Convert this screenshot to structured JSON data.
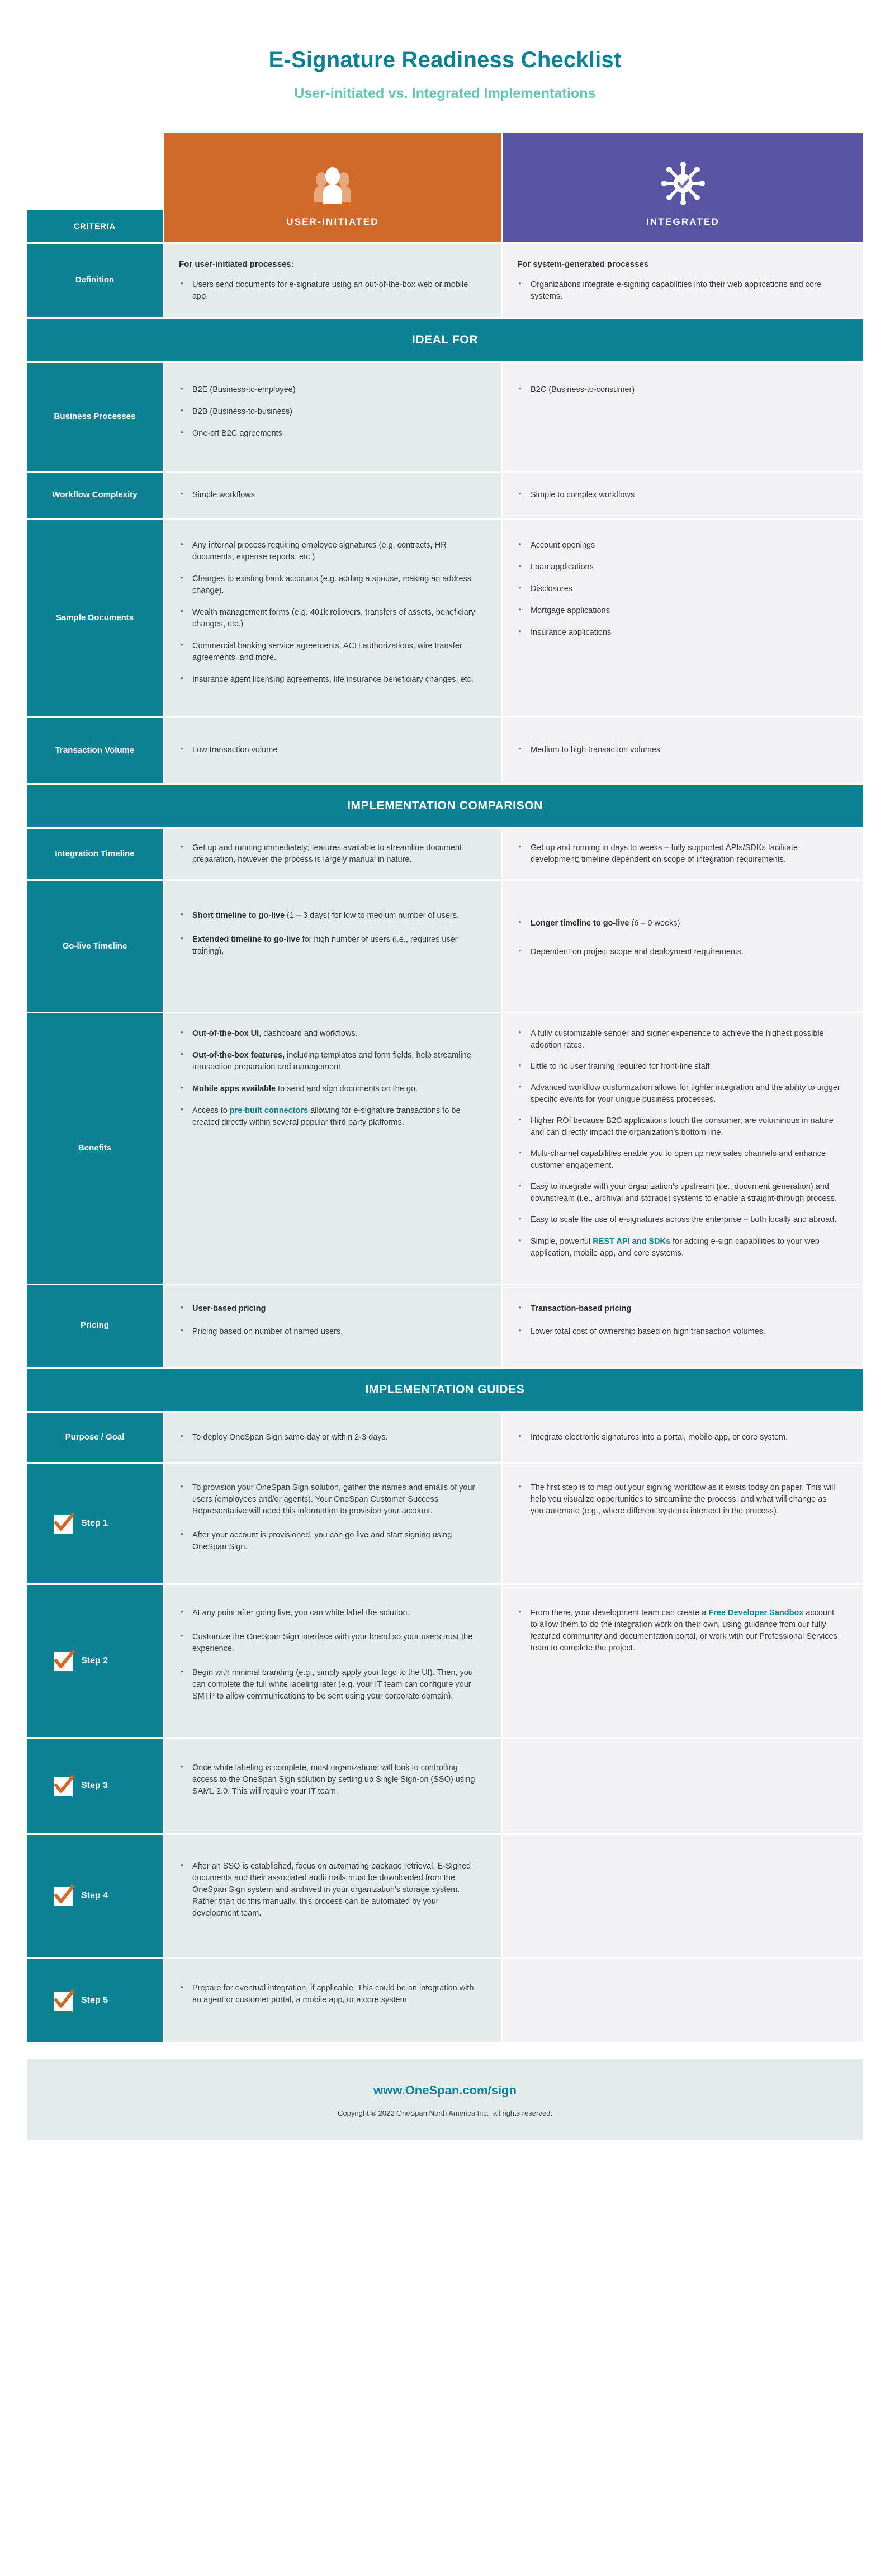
{
  "header": {
    "title": "E-Signature Readiness Checklist",
    "subtitle": "User-initiated vs. Integrated Implementations"
  },
  "colors": {
    "teal": "#0d8295",
    "title_teal": "#0b8294",
    "mint": "#63c6b3",
    "orange": "#d26a2c",
    "purple": "#5a55a3",
    "col_a_bg": "#e3ebeb",
    "col_b_bg": "#f1f1f6",
    "link": "#0d8295"
  },
  "table_head": {
    "criteria_label": "CRITERIA",
    "col_a_label": "USER-INITIATED",
    "col_b_label": "INTEGRATED",
    "col_a_icon": "users-group-icon",
    "col_b_icon": "integration-hub-check-icon"
  },
  "banners": {
    "ideal_for": "IDEAL FOR",
    "implementation_comparison": "IMPLEMENTATION COMPARISON",
    "implementation_guides": "IMPLEMENTATION GUIDES"
  },
  "rows": {
    "definition": {
      "label": "Definition",
      "a_lead": "For user-initiated processes:",
      "a_items": [
        "Users send documents for e-signature using an out-of-the-box web or mobile app."
      ],
      "b_lead": "For system-generated processes",
      "b_items": [
        "Organizations integrate e-signing capabilities into their web applications and core systems."
      ]
    },
    "business_processes": {
      "label": "Business Processes",
      "a_items": [
        "B2E (Business-to-employee)",
        "B2B (Business-to-business)",
        "One-off B2C agreements"
      ],
      "b_items": [
        "B2C (Business-to-consumer)"
      ]
    },
    "workflow_complexity": {
      "label": "Workflow Complexity",
      "a_items": [
        "Simple workflows"
      ],
      "b_items": [
        "Simple to complex workflows"
      ]
    },
    "sample_documents": {
      "label": "Sample Documents",
      "a_items": [
        "Any internal process requiring employee signatures (e.g. contracts, HR documents, expense reports, etc.).",
        "Changes to existing bank accounts (e.g. adding a spouse, making an address change).",
        "Wealth management forms (e.g. 401k rollovers, transfers of assets, beneficiary changes, etc.)",
        "Commercial banking service agreements, ACH authorizations, wire transfer agreements, and more.",
        "Insurance agent licensing agreements, life insurance beneficiary changes, etc."
      ],
      "b_items": [
        "Account openings",
        "Loan applications",
        "Disclosures",
        "Mortgage applications",
        "Insurance applications"
      ]
    },
    "transaction_volume": {
      "label": "Transaction Volume",
      "a_items": [
        "Low transaction volume"
      ],
      "b_items": [
        "Medium to high transaction volumes"
      ]
    },
    "integration_timeline": {
      "label": "Integration Timeline",
      "a_items": [
        "Get up and running immediately; features available to streamline document preparation, however the process is largely manual in nature."
      ],
      "b_items": [
        "Get up and running in days to weeks – fully supported APIs/SDKs facilitate development; timeline dependent on scope of integration requirements."
      ]
    },
    "golive_timeline": {
      "label": "Go-live Timeline",
      "a_items": [
        {
          "bold": "Short timeline to go-live",
          "rest": " (1 – 3 days) for low to medium number of users."
        },
        {
          "bold": "Extended timeline to go-live",
          "rest": " for high number of users (i.e., requires user training)."
        }
      ],
      "b_items": [
        {
          "bold": "Longer timeline to go-live",
          "rest": " (6 – 9 weeks)."
        },
        {
          "bold": "",
          "rest": "Dependent on project scope and deployment requirements."
        }
      ]
    },
    "benefits": {
      "label": "Benefits",
      "a_items": [
        {
          "bold": "Out-of-the-box UI",
          "rest": ", dashboard and workflows."
        },
        {
          "bold": "Out-of-the-box features,",
          "rest": " including templates and form fields, help streamline transaction preparation and management."
        },
        {
          "bold": "Mobile apps available",
          "rest": " to send and sign documents on the go."
        },
        {
          "pre": "Access to ",
          "link": "pre-built connectors",
          "rest": " allowing for e-signature transactions to be created directly within several popular third party platforms."
        }
      ],
      "b_items": [
        {
          "rest": "A fully customizable sender and signer experience to achieve the highest possible adoption rates."
        },
        {
          "rest": "Little to no user training required for front-line staff."
        },
        {
          "rest": "Advanced workflow customization allows for tighter integration and the ability to trigger specific events for your unique business processes."
        },
        {
          "rest": "Higher ROI because B2C applications touch the consumer, are voluminous in nature and can directly impact the organization's bottom line."
        },
        {
          "rest": "Multi-channel capabilities enable you to open up new sales channels and enhance customer engagement."
        },
        {
          "rest": "Easy to integrate with your organization's upstream (i.e., document generation) and downstream (i.e., archival and storage) systems to enable a straight-through process."
        },
        {
          "rest": "Easy to scale the use of e-signatures across the enterprise – both locally and abroad."
        },
        {
          "pre": "Simple, powerful ",
          "link": "REST API and SDKs",
          "rest": " for adding e-sign capabilities to your web application, mobile app, and core systems."
        }
      ]
    },
    "pricing": {
      "label": "Pricing",
      "a_items": [
        {
          "bold": "User-based pricing",
          "rest": ""
        },
        {
          "bold": "",
          "rest": "Pricing based on number of named users."
        }
      ],
      "b_items": [
        {
          "bold": "Transaction-based pricing",
          "rest": ""
        },
        {
          "bold": "",
          "rest": "Lower total cost of ownership based on high transaction volumes."
        }
      ]
    },
    "purpose_goal": {
      "label": "Purpose / Goal",
      "a_items": [
        "To deploy OneSpan Sign same-day or within 2-3 days."
      ],
      "b_items": [
        "Integrate electronic signatures into a portal, mobile app, or core system."
      ]
    }
  },
  "steps": [
    {
      "label": "Step 1",
      "icon": "checkbox-checked-icon",
      "a_items": [
        {
          "rest": "To provision your OneSpan Sign solution, gather the names and emails of your users (employees and/or agents). Your OneSpan Customer Success Representative will need this information to provision your account."
        },
        {
          "rest": "After your account is provisioned, you can go live and start signing using OneSpan Sign."
        }
      ],
      "b_items": [
        {
          "rest": "The first step is to map out your signing workflow as it exists today on paper. This will help you visualize opportunities to streamline the process, and what will change as you automate (e.g., where different systems intersect in the process)."
        }
      ]
    },
    {
      "label": "Step 2",
      "icon": "checkbox-checked-icon",
      "a_items": [
        {
          "rest": "At any point after going live, you can white label the solution."
        },
        {
          "rest": "Customize the OneSpan Sign interface with your brand so your users trust the experience."
        },
        {
          "rest": "Begin with minimal branding (e.g., simply apply your logo to the UI). Then, you can complete the full white labeling later (e.g. your IT team can configure your SMTP to allow communications to be sent using your corporate domain)."
        }
      ],
      "b_items": [
        {
          "pre": "From there, your development team can create a ",
          "link": "Free Developer Sandbox",
          "rest": " account to allow them to do the integration work on their own, using guidance from our fully featured community and documentation portal, or work with our Professional Services team to complete the project."
        }
      ]
    },
    {
      "label": "Step 3",
      "icon": "checkbox-checked-icon",
      "a_items": [
        {
          "rest": "Once white labeling is complete, most organizations will look to controlling access to the OneSpan Sign solution by setting up Single Sign-on (SSO) using SAML 2.0. This will require your IT team."
        }
      ],
      "b_items": []
    },
    {
      "label": "Step 4",
      "icon": "checkbox-checked-icon",
      "a_items": [
        {
          "rest": "After an SSO is established, focus on automating package retrieval. E-Signed documents and their associated audit trails must be downloaded from the OneSpan Sign system and archived in your organization's storage system. Rather than do this manually, this process can be automated by your development team."
        }
      ],
      "b_items": []
    },
    {
      "label": "Step 5",
      "icon": "checkbox-checked-icon",
      "a_items": [
        {
          "rest": "Prepare for eventual integration, if applicable. This could be an integration with an agent or customer portal, a mobile app, or a core system."
        }
      ],
      "b_items": []
    }
  ],
  "footer": {
    "url": "www.OneSpan.com/sign",
    "copyright": "Copyright ® 2022 OneSpan North America Inc., all rights reserved."
  }
}
